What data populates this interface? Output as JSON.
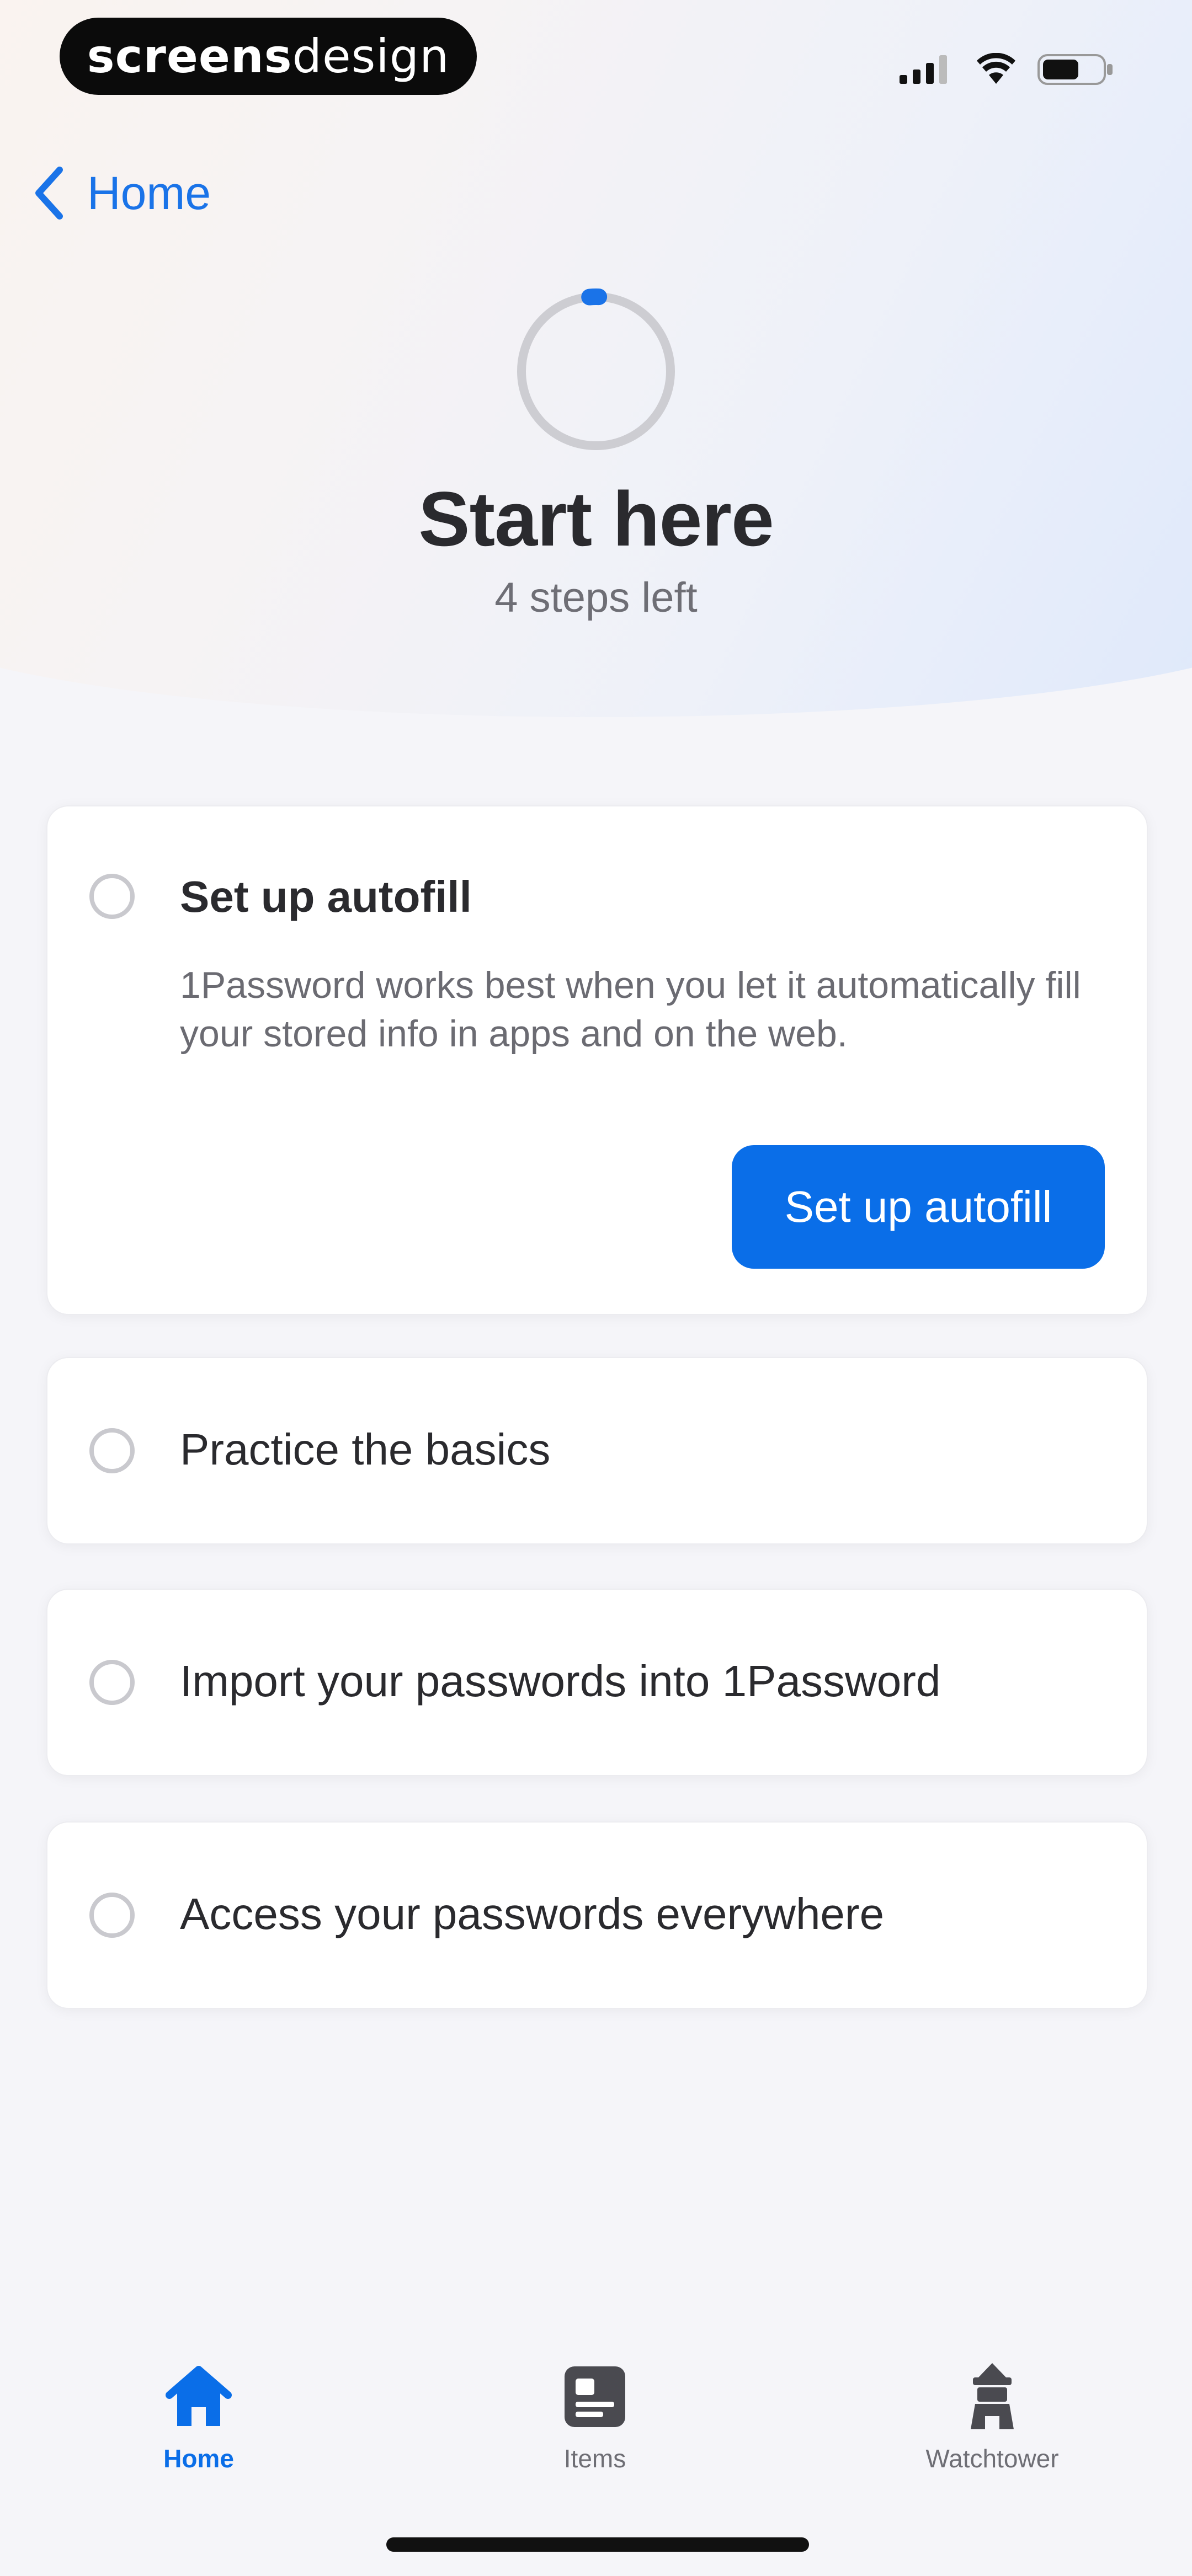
{
  "status_bar": {
    "brand_bold": "screens",
    "brand_thin": "design"
  },
  "nav": {
    "back_label": "Home"
  },
  "header": {
    "title": "Start here",
    "subtitle": "4 steps left",
    "progress_fraction": 0.02
  },
  "steps": [
    {
      "title": "Set up autofill",
      "description": "1Password works best when you let it automatically fill your stored info in apps and on the web.",
      "button_label": "Set up autofill",
      "completed": false
    },
    {
      "title": "Practice the basics",
      "completed": false
    },
    {
      "title": "Import your passwords into 1Password",
      "completed": false
    },
    {
      "title": "Access your passwords everywhere",
      "completed": false
    }
  ],
  "tab_bar": {
    "tabs": [
      {
        "label": "Home",
        "icon": "home-icon",
        "selected": true
      },
      {
        "label": "Items",
        "icon": "items-icon",
        "selected": false
      },
      {
        "label": "Watchtower",
        "icon": "watchtower-icon",
        "selected": false
      }
    ]
  },
  "colors": {
    "accent": "#0a6ee8",
    "text_primary": "#2a2a2e",
    "text_secondary": "#6e6e75"
  }
}
